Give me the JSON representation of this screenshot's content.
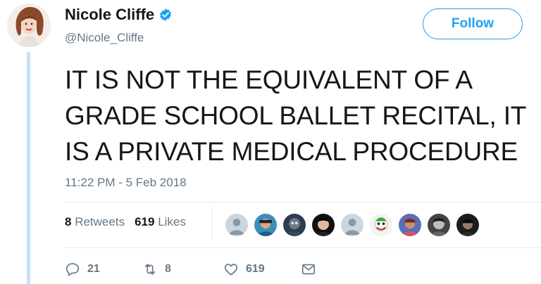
{
  "author": {
    "name": "Nicole Cliffe",
    "handle": "@Nicole_Cliffe",
    "verified_icon": "verified-badge-icon"
  },
  "follow_button": {
    "label": "Follow"
  },
  "tweet": {
    "text_lines": [
      "IT IS NOT THE EQUIVALENT OF A",
      "GRADE SCHOOL BALLET RECITAL, IT",
      "IS A PRIVATE MEDICAL PROCEDURE"
    ],
    "timestamp": "11:22 PM - 5 Feb 2018"
  },
  "stats": {
    "retweets_count": "8",
    "retweets_label": "Retweets",
    "likes_count": "619",
    "likes_label": "Likes"
  },
  "actions": {
    "replies": "21",
    "retweets": "8",
    "likes": "619"
  },
  "colors": {
    "accent": "#1da1f2",
    "thread_line": "#c4e2f7",
    "muted_text": "#657786"
  }
}
